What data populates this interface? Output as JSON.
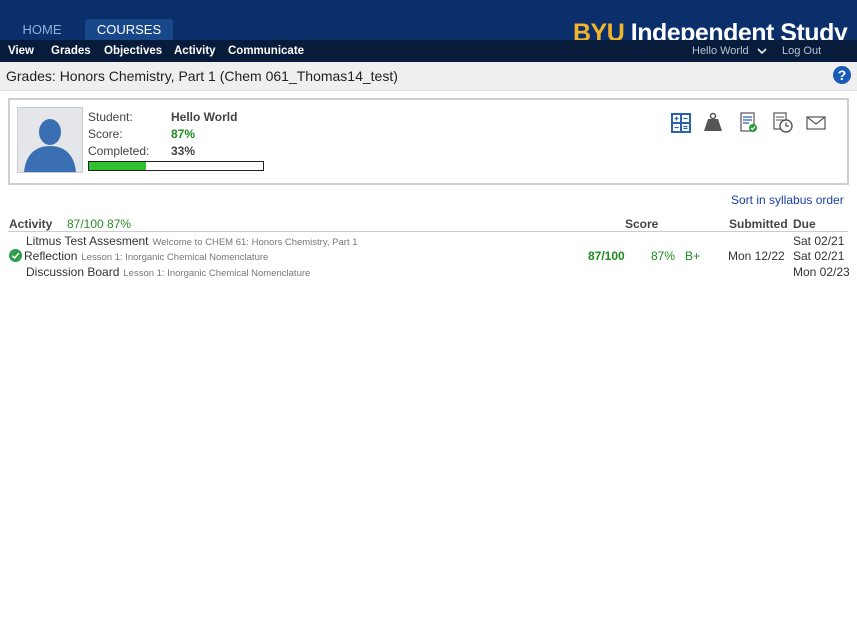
{
  "header": {
    "tabs": [
      {
        "label": "HOME"
      },
      {
        "label": "COURSES"
      }
    ],
    "brand": {
      "primary": "BYU",
      "secondary": "Independent Study"
    }
  },
  "nav": {
    "items": [
      {
        "label": "View"
      },
      {
        "label": "Grades"
      },
      {
        "label": "Objectives"
      },
      {
        "label": "Activity"
      },
      {
        "label": "Communicate"
      }
    ],
    "user": "Hello World",
    "logout": "Log Out"
  },
  "page": {
    "title": "Grades: Honors Chemistry, Part 1 (Chem 061_Thomas14_test)",
    "help": "?"
  },
  "student": {
    "student_label": "Student:",
    "student_value": "Hello World",
    "score_label": "Score:",
    "score_value": "87%",
    "completed_label": "Completed:",
    "completed_value": "33%",
    "progress_fraction": 0.33
  },
  "sort_link": "Sort in syllabus order",
  "table": {
    "headers": {
      "activity": "Activity",
      "activity_summary": "87/100 87%",
      "score": "Score",
      "submitted": "Submitted",
      "due": "Due"
    },
    "rows": [
      {
        "name": "Litmus Test Assesment",
        "subtitle": "Welcome to CHEM 61: Honors Chemistry, Part 1",
        "points": "",
        "percent": "",
        "grade": "",
        "submitted": "",
        "due": "Sat 02/21",
        "completed": false
      },
      {
        "name": "Reflection",
        "subtitle": "Lesson 1: Inorganic Chemical Nomenclature",
        "points": "87/100",
        "percent": "87%",
        "grade": "B+",
        "submitted": "Mon 12/22",
        "due": "Sat 02/21",
        "completed": true
      },
      {
        "name": "Discussion Board",
        "subtitle": "Lesson 1: Inorganic Chemical Nomenclature",
        "points": "",
        "percent": "",
        "grade": "",
        "submitted": "",
        "due": "Mon 02/23",
        "completed": false
      }
    ]
  },
  "colors": {
    "header_bg": "#0a2f6b",
    "nav_bg": "#071c3b",
    "brand_gold": "#f1b42a",
    "score_green": "#1e8a1e",
    "progress_green": "#2fc12f",
    "link_blue": "#1a3fa5"
  },
  "icons": [
    "calculator-icon",
    "weight-icon",
    "report-icon",
    "history-icon",
    "mail-icon",
    "check-icon",
    "user-avatar"
  ]
}
